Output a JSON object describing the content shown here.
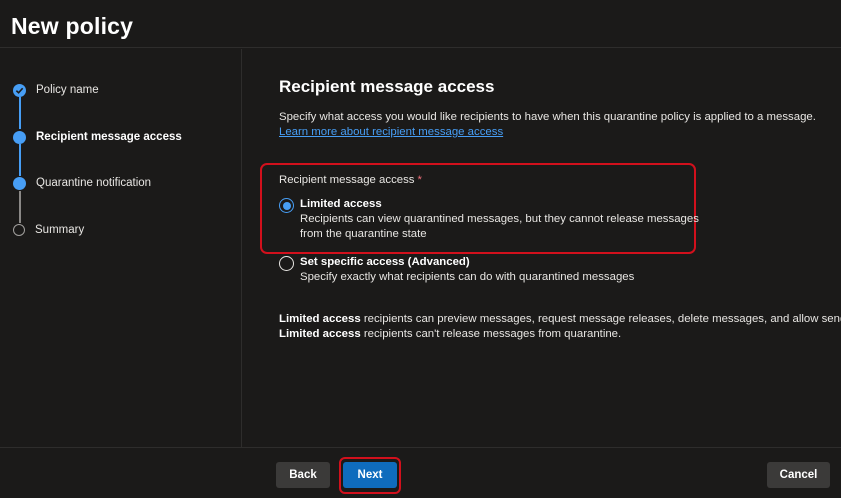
{
  "header": {
    "title": "New policy"
  },
  "steps": [
    {
      "label": "Policy name",
      "state": "completed"
    },
    {
      "label": "Recipient message access",
      "state": "current"
    },
    {
      "label": "Quarantine notification",
      "state": "upcoming-filled"
    },
    {
      "label": "Summary",
      "state": "upcoming"
    }
  ],
  "main": {
    "section_title": "Recipient message access",
    "description": "Specify what access you would like recipients to have when this quarantine policy is applied to a message.",
    "learn_more_link": "Learn more about recipient message access",
    "field_label": "Recipient message access",
    "required_mark": "*",
    "options": [
      {
        "title": "Limited access",
        "description": "Recipients can view quarantined messages, but they cannot release messages from the quarantine state",
        "selected": true
      },
      {
        "title": "Set specific access (Advanced)",
        "description": "Specify exactly what recipients can do with quarantined messages",
        "selected": false
      }
    ],
    "notes": [
      {
        "bold": "Limited access",
        "text": " recipients can preview messages, request message releases, delete messages, and allow senders."
      },
      {
        "bold": "Limited access",
        "text": " recipients can't release messages from quarantine."
      }
    ]
  },
  "footer": {
    "back_label": "Back",
    "next_label": "Next",
    "cancel_label": "Cancel"
  },
  "colors": {
    "accent": "#479ef5",
    "primary_button": "#0f6cbd",
    "highlight": "#d2101c",
    "background": "#1b1a19"
  }
}
